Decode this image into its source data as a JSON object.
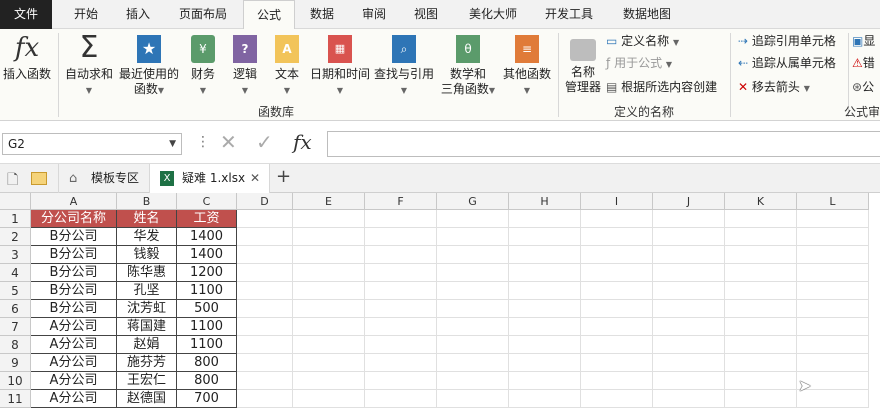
{
  "menu": {
    "file": "文件",
    "tabs": [
      "开始",
      "插入",
      "页面布局",
      "公式",
      "数据",
      "审阅",
      "视图",
      "美化大师",
      "开发工具",
      "数据地图"
    ],
    "active": "公式"
  },
  "ribbon": {
    "insert_function": "插入函数",
    "autosum": "自动求和",
    "recent": [
      "最近使用的",
      "函数"
    ],
    "finance": "财务",
    "logic": "逻辑",
    "text": "文本",
    "datetime": "日期和时间",
    "lookup": "查找与引用",
    "math": [
      "数学和",
      "三角函数"
    ],
    "other": "其他函数",
    "group_library": "函数库",
    "name_manager": [
      "名称",
      "管理器"
    ],
    "define_name": "定义名称",
    "use_in_formula": "用于公式",
    "create_from_selection": "根据所选内容创建",
    "group_names": "定义的名称",
    "trace_precedents": "追踪引用单元格",
    "trace_dependents": "追踪从属单元格",
    "remove_arrows": "移去箭头",
    "show_formulas_partial": "显",
    "error_check_partial": "错",
    "evaluate_partial": "公",
    "group_audit_partial": "公式审"
  },
  "formula_bar": {
    "name_box": "G2",
    "formula": ""
  },
  "tabs": {
    "template_area": "模板专区",
    "file_name": "疑难 1.xlsx"
  },
  "sheet": {
    "columns": [
      "A",
      "B",
      "C",
      "D",
      "E",
      "F",
      "G",
      "H",
      "I",
      "J",
      "K",
      "L"
    ],
    "rows": [
      "1",
      "2",
      "3",
      "4",
      "5",
      "6",
      "7",
      "8",
      "9",
      "10",
      "11"
    ],
    "headers": [
      "分公司名称",
      "姓名",
      "工资"
    ],
    "data": [
      [
        "B分公司",
        "华发",
        "1400"
      ],
      [
        "B分公司",
        "钱毅",
        "1400"
      ],
      [
        "B分公司",
        "陈华惠",
        "1200"
      ],
      [
        "B分公司",
        "孔坚",
        "1100"
      ],
      [
        "B分公司",
        "沈芳虹",
        "500"
      ],
      [
        "A分公司",
        "蒋国建",
        "1100"
      ],
      [
        "A分公司",
        "赵娟",
        "1100"
      ],
      [
        "A分公司",
        "施芬芳",
        "800"
      ],
      [
        "A分公司",
        "王宏仁",
        "800"
      ],
      [
        "A分公司",
        "赵德国",
        "700"
      ]
    ],
    "header_color": "#c0504d"
  }
}
